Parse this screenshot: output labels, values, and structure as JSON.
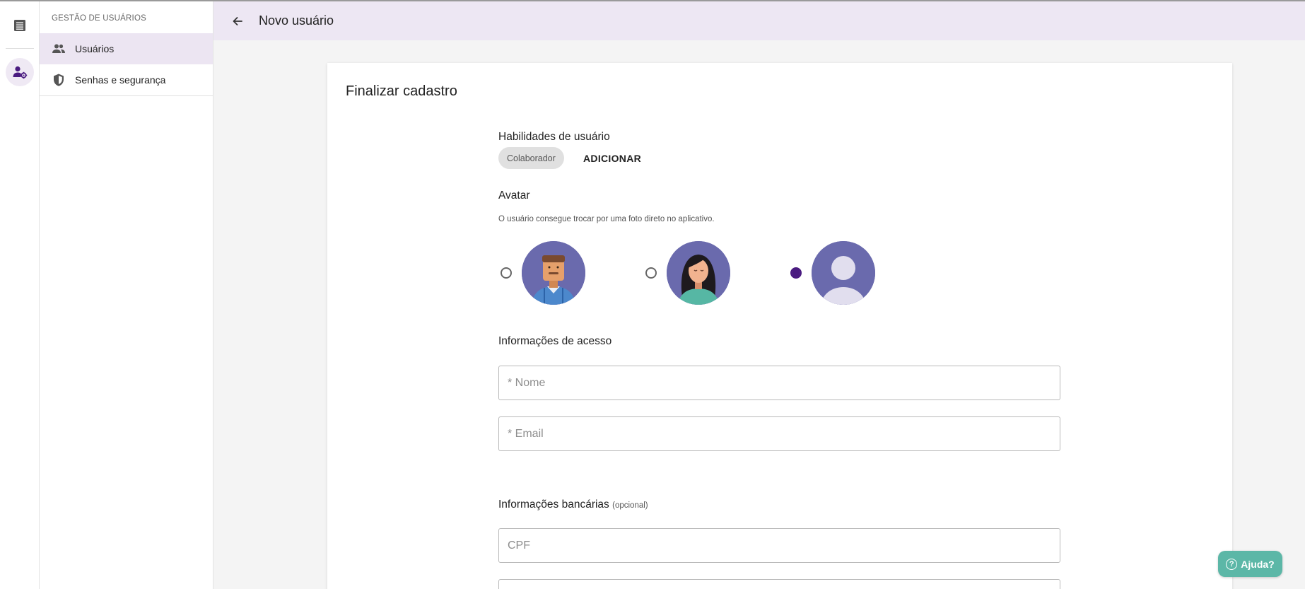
{
  "colors": {
    "accent": "#4a1b80",
    "header_bg": "#ede7f3",
    "avatar_bg": "#6a6aad",
    "help_bg": "#5cb7a7"
  },
  "rail": {
    "icons": [
      "list-icon",
      "user-settings-icon"
    ]
  },
  "sidebar": {
    "title": "GESTÃO DE USUÁRIOS",
    "items": [
      {
        "label": "Usuários",
        "icon": "people-icon",
        "active": true
      },
      {
        "label": "Senhas e segurança",
        "icon": "shield-icon",
        "active": false
      }
    ]
  },
  "header": {
    "title": "Novo usuário",
    "back_icon": "arrow-left-icon"
  },
  "card": {
    "title": "Finalizar cadastro",
    "skills": {
      "label": "Habilidades de usuário",
      "chip": "Colaborador",
      "add_label": "ADICIONAR"
    },
    "avatar": {
      "label": "Avatar",
      "hint": "O usuário consegue trocar por uma foto direto no aplicativo.",
      "options": [
        {
          "name": "avatar-man",
          "selected": false
        },
        {
          "name": "avatar-woman",
          "selected": false
        },
        {
          "name": "avatar-default",
          "selected": true
        }
      ]
    },
    "access": {
      "label": "Informações de acesso",
      "name_placeholder": "* Nome",
      "email_placeholder": "* Email"
    },
    "banking": {
      "label": "Informações bancárias",
      "optional": "(opcional)",
      "cpf_placeholder": "CPF"
    }
  },
  "help": {
    "label": "Ajuda?",
    "icon": "?"
  }
}
